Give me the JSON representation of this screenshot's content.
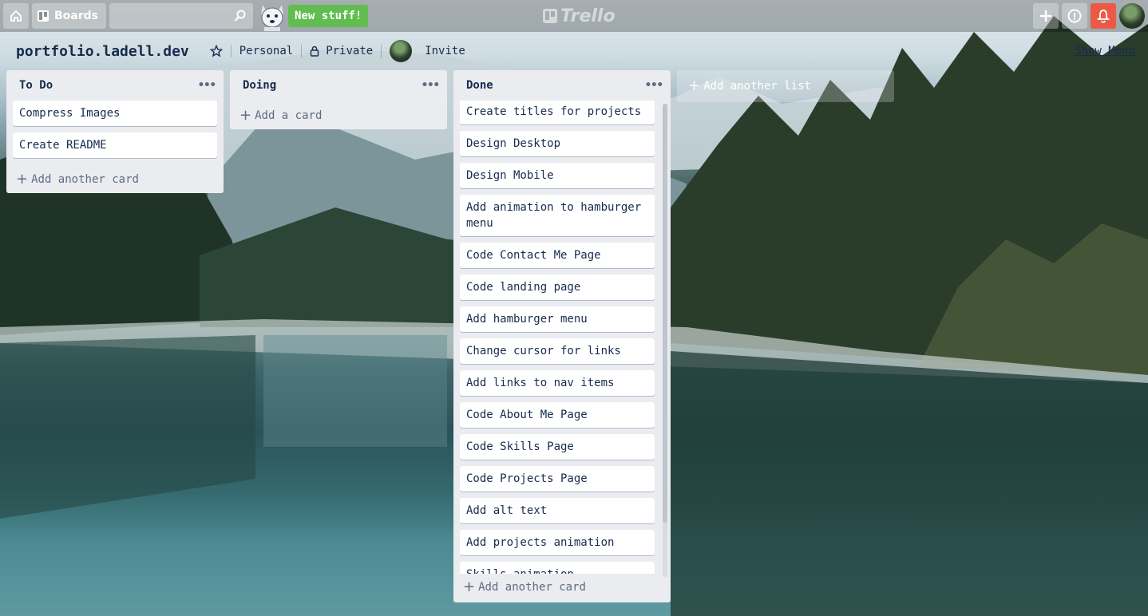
{
  "header": {
    "boards_label": "Boards",
    "search_placeholder": "",
    "new_stuff_label": "New stuff!",
    "logo_text": "Trello"
  },
  "board": {
    "title": "portfolio.ladell.dev",
    "team_label": "Personal",
    "visibility_label": "Private",
    "invite_label": "Invite",
    "show_menu_label": "Show Menu"
  },
  "lists": [
    {
      "title": "To Do",
      "cards": [
        "Compress Images",
        "Create README"
      ],
      "add_label": "Add another card"
    },
    {
      "title": "Doing",
      "cards": [],
      "add_label": "Add a card"
    },
    {
      "title": "Done",
      "cards": [
        "Create titles for projects",
        "Design Desktop",
        "Design Mobile",
        "Add animation to hamburger menu",
        "Code Contact Me Page",
        "Code landing page",
        "Add hamburger menu",
        "Change cursor for links",
        "Add links to nav items",
        "Code About Me Page",
        "Code Skills Page",
        "Code Projects Page",
        "Add alt text",
        "Add projects animation",
        "Skills animation"
      ],
      "add_label": "Add another card"
    }
  ],
  "add_list_label": "Add another list",
  "colors": {
    "header_bg": "rgba(0,0,0,0.25)",
    "new_stuff_green": "#61bd4f",
    "notification_red": "#eb5a46",
    "list_bg": "#ebecf0"
  },
  "icons": [
    "home-icon",
    "board-icon",
    "search-icon",
    "plus-icon",
    "info-icon",
    "bell-icon",
    "star-icon",
    "lock-icon",
    "more-icon"
  ]
}
